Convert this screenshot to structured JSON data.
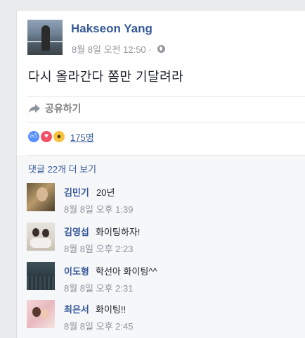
{
  "post": {
    "author": "Hakseon Yang",
    "timestamp": "8월 8일 오전 12:50 ·",
    "privacy_icon": "globe-icon",
    "text": "다시 올라간다 쫌만 기달려라"
  },
  "actions": {
    "share_label": "공유하기"
  },
  "reactions": {
    "types": [
      "like",
      "love",
      "wow"
    ],
    "count": "175명"
  },
  "comments_section": {
    "view_more": "댓글 22개 더 보기",
    "comments": [
      {
        "name": "김민기",
        "text": "20년",
        "time": "8월 8일 오후 1:39"
      },
      {
        "name": "김영섭",
        "text": "화이팅하자!",
        "time": "8월 8일 오후 2:23"
      },
      {
        "name": "이도형",
        "text": "학선아 화이팅^^",
        "time": "8월 8일 오후 2:31"
      },
      {
        "name": "최은서",
        "text": "화이팅!!",
        "time": "8월 8일 오후 2:45"
      }
    ]
  },
  "colors": {
    "link": "#365899",
    "muted": "#90949c",
    "text": "#1d2129",
    "like": "#5890ff",
    "love": "#f25268",
    "wow": "#f7c23f"
  }
}
